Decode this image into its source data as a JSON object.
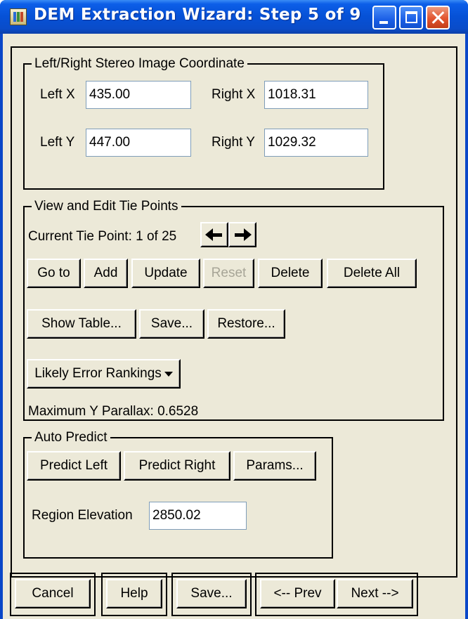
{
  "window": {
    "title": "DEM Extraction Wizard: Step 5 of 9",
    "icon": "dem-app-icon",
    "controls": [
      "minimize-icon",
      "maximize-icon",
      "close-icon"
    ]
  },
  "coordinates": {
    "legend": "Left/Right Stereo Image Coordinate",
    "left_x_label": "Left X",
    "left_x_value": "435.00",
    "right_x_label": "Right X",
    "right_x_value": "1018.31",
    "left_y_label": "Left Y",
    "left_y_value": "447.00",
    "right_y_label": "Right Y",
    "right_y_value": "1029.32"
  },
  "tie_points": {
    "legend": "View and Edit Tie Points",
    "current_label": "Current Tie Point: 1 of 25",
    "prev_icon": "arrow-left-icon",
    "next_icon": "arrow-right-icon",
    "buttons_row1": [
      "Go to",
      "Add",
      "Update",
      "Reset",
      "Delete",
      "Delete All"
    ],
    "reset_disabled": true,
    "buttons_row2": [
      "Show Table...",
      "Save...",
      "Restore..."
    ],
    "rankings_label": "Likely Error Rankings",
    "parallax_label": "Maximum Y Parallax: 0.6528"
  },
  "auto_predict": {
    "legend": "Auto Predict",
    "buttons": [
      "Predict Left",
      "Predict Right",
      "Params..."
    ],
    "elevation_label": "Region Elevation",
    "elevation_value": "2850.02"
  },
  "footer": {
    "cancel": "Cancel",
    "help": "Help",
    "save": "Save...",
    "prev": "<-- Prev",
    "next": "Next -->"
  }
}
